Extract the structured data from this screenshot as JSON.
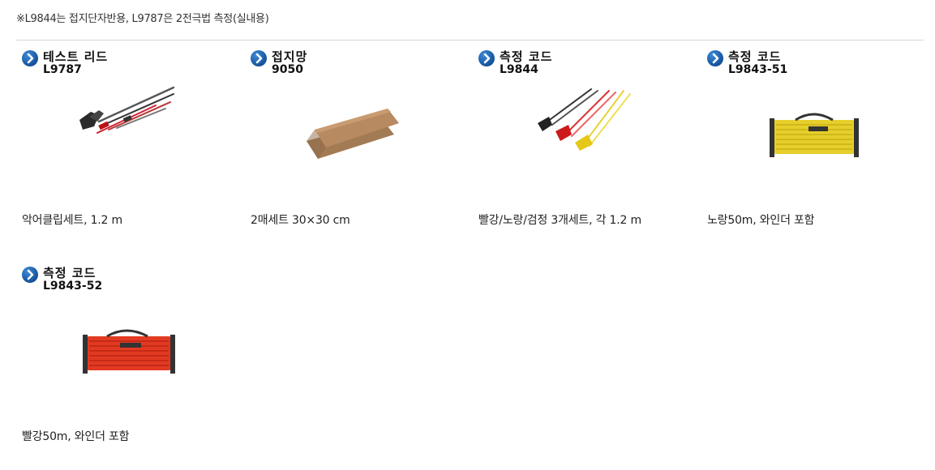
{
  "note": "※L9844는 접지단자반용, L9787은 2전극법 측정(실내용)",
  "items": [
    {
      "name": "테스트 리드",
      "model": "L9787",
      "desc": "악어클립세트, 1.2 m",
      "icon": "chevron-right-icon"
    },
    {
      "name": "접지망",
      "model": "9050",
      "desc": "2매세트 30×30 cm",
      "icon": "chevron-right-icon"
    },
    {
      "name": "측정 코드",
      "model": "L9844",
      "desc": "빨강/노랑/검정 3개세트, 각 1.2 m",
      "icon": "chevron-right-icon"
    },
    {
      "name": "측정 코드",
      "model": "L9843-51",
      "desc": "노랑50m, 와인더 포함",
      "icon": "chevron-right-icon"
    },
    {
      "name": "측정 코드",
      "model": "L9843-52",
      "desc": "빨강50m, 와인더 포함",
      "icon": "chevron-right-icon"
    }
  ],
  "colors": {
    "accent": "#1b5ea8",
    "divider": "#d6d6d6"
  }
}
